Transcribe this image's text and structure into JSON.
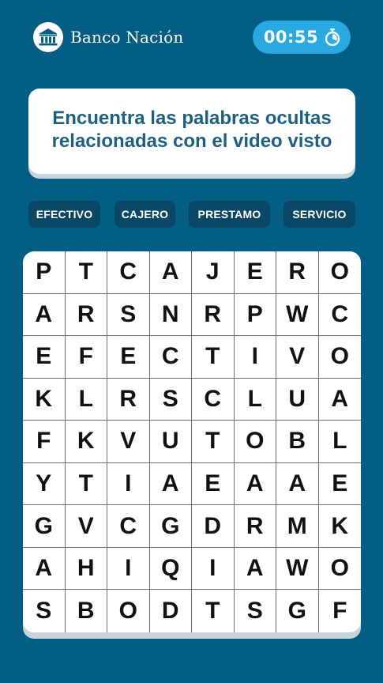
{
  "brand": {
    "name": "Banco Nación",
    "logo_icon": "bank-building-icon"
  },
  "timer": {
    "value": "00:55",
    "icon": "stopwatch-icon",
    "bg_color": "#29a9e1"
  },
  "instruction": {
    "line1": "Encuentra las palabras ocultas",
    "line2": "relacionadas con el video visto"
  },
  "words": [
    "EFECTIVO",
    "CAJERO",
    "PRESTAMO",
    "SERVICIO"
  ],
  "grid": [
    [
      "P",
      "T",
      "C",
      "A",
      "J",
      "E",
      "R",
      "O"
    ],
    [
      "A",
      "R",
      "S",
      "N",
      "R",
      "P",
      "W",
      "C"
    ],
    [
      "E",
      "F",
      "E",
      "C",
      "T",
      "I",
      "V",
      "O"
    ],
    [
      "K",
      "L",
      "R",
      "S",
      "C",
      "L",
      "U",
      "A"
    ],
    [
      "F",
      "K",
      "V",
      "U",
      "T",
      "O",
      "B",
      "L"
    ],
    [
      "Y",
      "T",
      "I",
      "A",
      "E",
      "A",
      "A",
      "E"
    ],
    [
      "G",
      "V",
      "C",
      "G",
      "D",
      "R",
      "M",
      "K"
    ],
    [
      "A",
      "H",
      "I",
      "Q",
      "I",
      "A",
      "W",
      "O"
    ],
    [
      "S",
      "B",
      "O",
      "D",
      "T",
      "S",
      "G",
      "F"
    ]
  ],
  "colors": {
    "background": "#035e85",
    "chip": "#0a4766",
    "instruction_text": "#1d5f82"
  }
}
